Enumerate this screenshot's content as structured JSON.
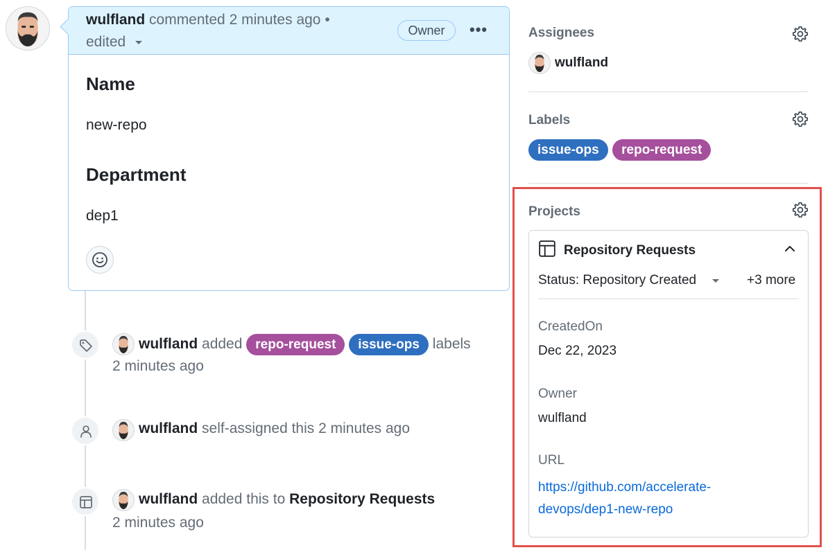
{
  "comment": {
    "author": "wulfland",
    "meta": "commented 2 minutes ago •",
    "edited": "edited",
    "owner_badge": "Owner",
    "more": "•••",
    "heading_name": "Name",
    "value_name": "new-repo",
    "heading_department": "Department",
    "value_department": "dep1"
  },
  "timeline": {
    "labels_event": {
      "actor": "wulfland",
      "verb": "added",
      "labels": [
        "repo-request",
        "issue-ops"
      ],
      "suffix": "labels",
      "time": "2 minutes ago"
    },
    "assign_event": {
      "actor": "wulfland",
      "text": "self-assigned this 2 minutes ago"
    },
    "project_event": {
      "actor": "wulfland",
      "verb": "added this to",
      "project": "Repository Requests",
      "time": "2 minutes ago"
    }
  },
  "sidebar": {
    "assignees": {
      "title": "Assignees",
      "user": "wulfland"
    },
    "labels": {
      "title": "Labels",
      "items": [
        "issue-ops",
        "repo-request"
      ]
    },
    "projects": {
      "title": "Projects",
      "project_name": "Repository Requests",
      "status": "Status: Repository Created",
      "more": "+3 more",
      "fields": {
        "created_label": "CreatedOn",
        "created_value": "Dec 22, 2023",
        "owner_label": "Owner",
        "owner_value": "wulfland",
        "url_label": "URL",
        "url_line1": "https://github.com/accelerate-",
        "url_line2": "devops/dep1-new-repo"
      }
    }
  },
  "colors": {
    "label_blue": "#2f6fbf",
    "label_purple": "#a54f9d",
    "highlight_frame": "#e0504a",
    "link": "#0969da",
    "comment_header_bg": "#ddf4ff"
  },
  "icons": [
    "avatar",
    "tag-icon",
    "person-icon",
    "table-icon",
    "gear-icon",
    "smiley-icon",
    "chevron-up-icon",
    "caret-down-icon",
    "kebab-icon"
  ]
}
